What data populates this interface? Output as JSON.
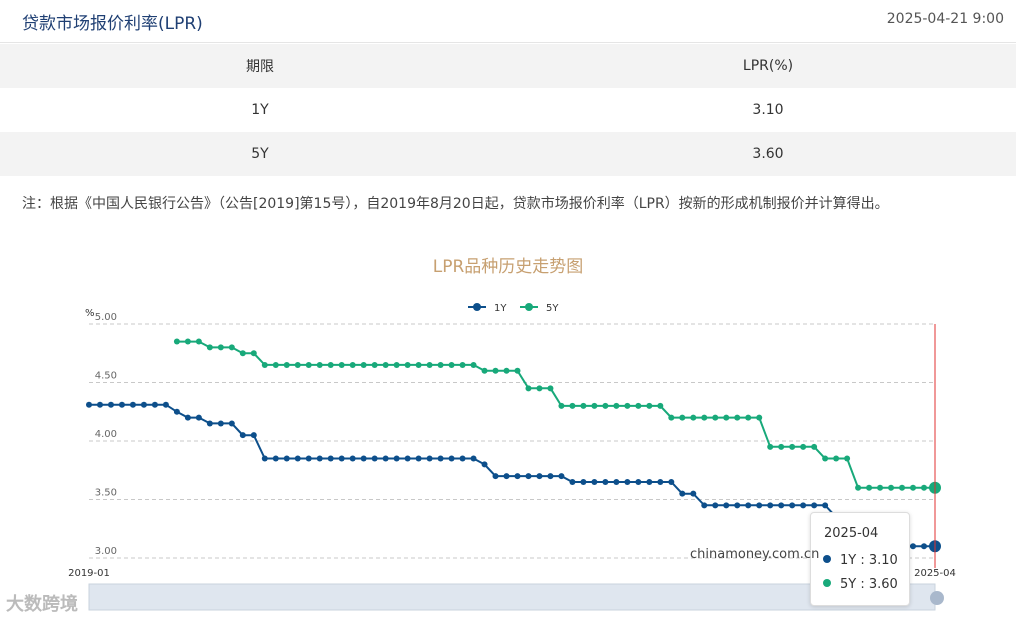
{
  "header": {
    "title": "贷款市场报价利率(LPR)",
    "timestamp": "2025-04-21 9:00"
  },
  "table": {
    "headers": [
      "期限",
      "LPR(%)"
    ],
    "rows": [
      [
        "1Y",
        "3.10"
      ],
      [
        "5Y",
        "3.60"
      ]
    ]
  },
  "note": "注：根据《中国人民银行公告》（公告[2019]第15号），自2019年8月20日起，贷款市场报价利率（LPR）按新的形成机制报价并计算得出。",
  "chart_data": {
    "type": "line",
    "title": "LPR品种历史走势图",
    "ylabel": "%",
    "ylim": [
      3.0,
      5.0
    ],
    "yticks": [
      "5.00",
      "4.50",
      "4.00",
      "3.50",
      "3.00"
    ],
    "x_start_label": "2019-01",
    "x_end_label": "2025-04",
    "legend": "top-center",
    "grid": "dashed horizontal",
    "series": [
      {
        "name": "1Y",
        "color": "#0d4f8b",
        "values": [
          4.31,
          4.31,
          4.31,
          4.31,
          4.31,
          4.31,
          4.31,
          4.31,
          4.25,
          4.2,
          4.2,
          4.15,
          4.15,
          4.15,
          4.05,
          4.05,
          3.85,
          3.85,
          3.85,
          3.85,
          3.85,
          3.85,
          3.85,
          3.85,
          3.85,
          3.85,
          3.85,
          3.85,
          3.85,
          3.85,
          3.85,
          3.85,
          3.85,
          3.85,
          3.85,
          3.85,
          3.8,
          3.7,
          3.7,
          3.7,
          3.7,
          3.7,
          3.7,
          3.7,
          3.65,
          3.65,
          3.65,
          3.65,
          3.65,
          3.65,
          3.65,
          3.65,
          3.65,
          3.65,
          3.55,
          3.55,
          3.45,
          3.45,
          3.45,
          3.45,
          3.45,
          3.45,
          3.45,
          3.45,
          3.45,
          3.45,
          3.45,
          3.45,
          3.35,
          3.35,
          3.35,
          3.1,
          3.1,
          3.1,
          3.1,
          3.1,
          3.1,
          3.1
        ]
      },
      {
        "name": "5Y",
        "color": "#18a97a",
        "values": [
          null,
          null,
          null,
          null,
          null,
          null,
          null,
          null,
          4.85,
          4.85,
          4.85,
          4.8,
          4.8,
          4.8,
          4.75,
          4.75,
          4.65,
          4.65,
          4.65,
          4.65,
          4.65,
          4.65,
          4.65,
          4.65,
          4.65,
          4.65,
          4.65,
          4.65,
          4.65,
          4.65,
          4.65,
          4.65,
          4.65,
          4.65,
          4.65,
          4.65,
          4.6,
          4.6,
          4.6,
          4.6,
          4.45,
          4.45,
          4.45,
          4.3,
          4.3,
          4.3,
          4.3,
          4.3,
          4.3,
          4.3,
          4.3,
          4.3,
          4.3,
          4.2,
          4.2,
          4.2,
          4.2,
          4.2,
          4.2,
          4.2,
          4.2,
          4.2,
          3.95,
          3.95,
          3.95,
          3.95,
          3.95,
          3.85,
          3.85,
          3.85,
          3.6,
          3.6,
          3.6,
          3.6,
          3.6,
          3.6,
          3.6,
          3.6
        ]
      }
    ],
    "tooltip": {
      "date": "2025-04",
      "entries": [
        {
          "name": "1Y",
          "value": "3.10",
          "color": "#0d4f8b"
        },
        {
          "name": "5Y",
          "value": "3.60",
          "color": "#18a97a"
        }
      ]
    }
  },
  "watermarks": {
    "site": "chinamoney.com.cn",
    "brand": "大数跨境"
  }
}
